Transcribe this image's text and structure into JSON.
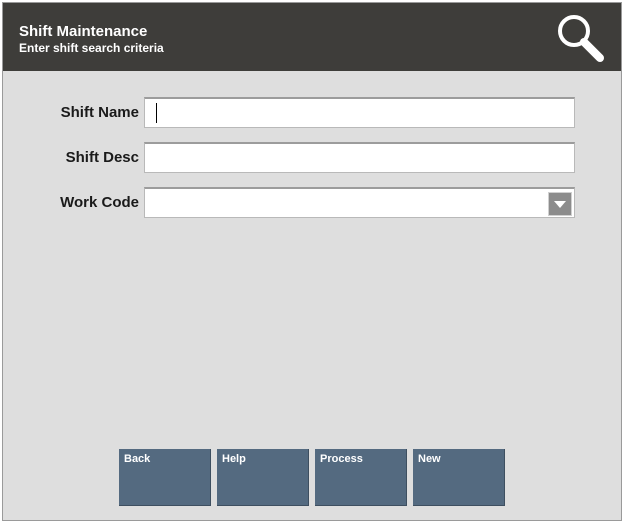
{
  "header": {
    "title": "Shift Maintenance",
    "subtitle": "Enter shift search criteria",
    "icon": "search-icon"
  },
  "form": {
    "shift_name": {
      "label": "Shift Name",
      "value": ""
    },
    "shift_desc": {
      "label": "Shift Desc",
      "value": ""
    },
    "work_code": {
      "label": "Work Code",
      "value": "",
      "dropdown_icon": "chevron-down-icon"
    }
  },
  "buttons": {
    "back": "Back",
    "help": "Help",
    "process": "Process",
    "new": "New"
  },
  "colors": {
    "header_bg": "#3e3d3a",
    "body_bg": "#dedede",
    "button_bg": "#546a80"
  }
}
